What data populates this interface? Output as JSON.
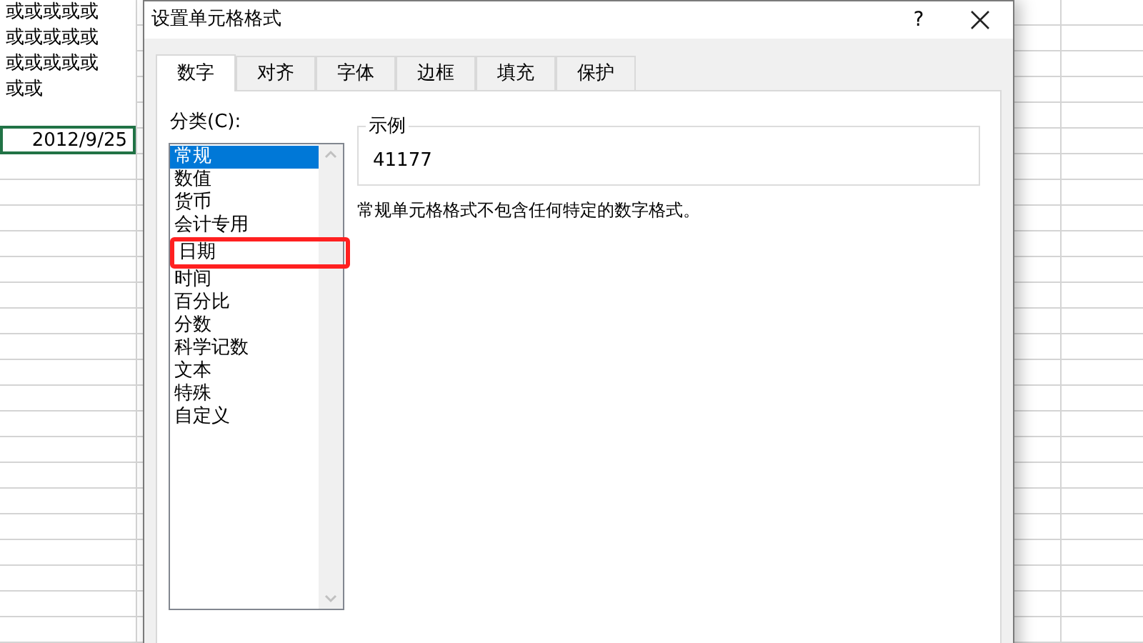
{
  "sheet": {
    "cells": [
      {
        "text": "或或或或或或或或或或或或或或或或或",
        "selected": false,
        "kind": "text"
      },
      {
        "text": "2012/9/25",
        "selected": true,
        "kind": "date"
      }
    ]
  },
  "dialog": {
    "title": "设置单元格格式",
    "help": "?",
    "tabs": [
      {
        "label": "数字",
        "selected": true
      },
      {
        "label": "对齐",
        "selected": false
      },
      {
        "label": "字体",
        "selected": false
      },
      {
        "label": "边框",
        "selected": false
      },
      {
        "label": "填充",
        "selected": false
      },
      {
        "label": "保护",
        "selected": false
      }
    ],
    "category_label": "分类(C):",
    "categories": [
      {
        "label": "常规",
        "selected": true,
        "highlighted": false
      },
      {
        "label": "数值",
        "selected": false,
        "highlighted": false
      },
      {
        "label": "货币",
        "selected": false,
        "highlighted": false
      },
      {
        "label": "会计专用",
        "selected": false,
        "highlighted": false
      },
      {
        "label": "日期",
        "selected": false,
        "highlighted": true
      },
      {
        "label": "时间",
        "selected": false,
        "highlighted": false
      },
      {
        "label": "百分比",
        "selected": false,
        "highlighted": false
      },
      {
        "label": "分数",
        "selected": false,
        "highlighted": false
      },
      {
        "label": "科学记数",
        "selected": false,
        "highlighted": false
      },
      {
        "label": "文本",
        "selected": false,
        "highlighted": false
      },
      {
        "label": "特殊",
        "selected": false,
        "highlighted": false
      },
      {
        "label": "自定义",
        "selected": false,
        "highlighted": false
      }
    ],
    "sample": {
      "legend": "示例",
      "value": "41177"
    },
    "description": "常规单元格格式不包含任何特定的数字格式。"
  }
}
